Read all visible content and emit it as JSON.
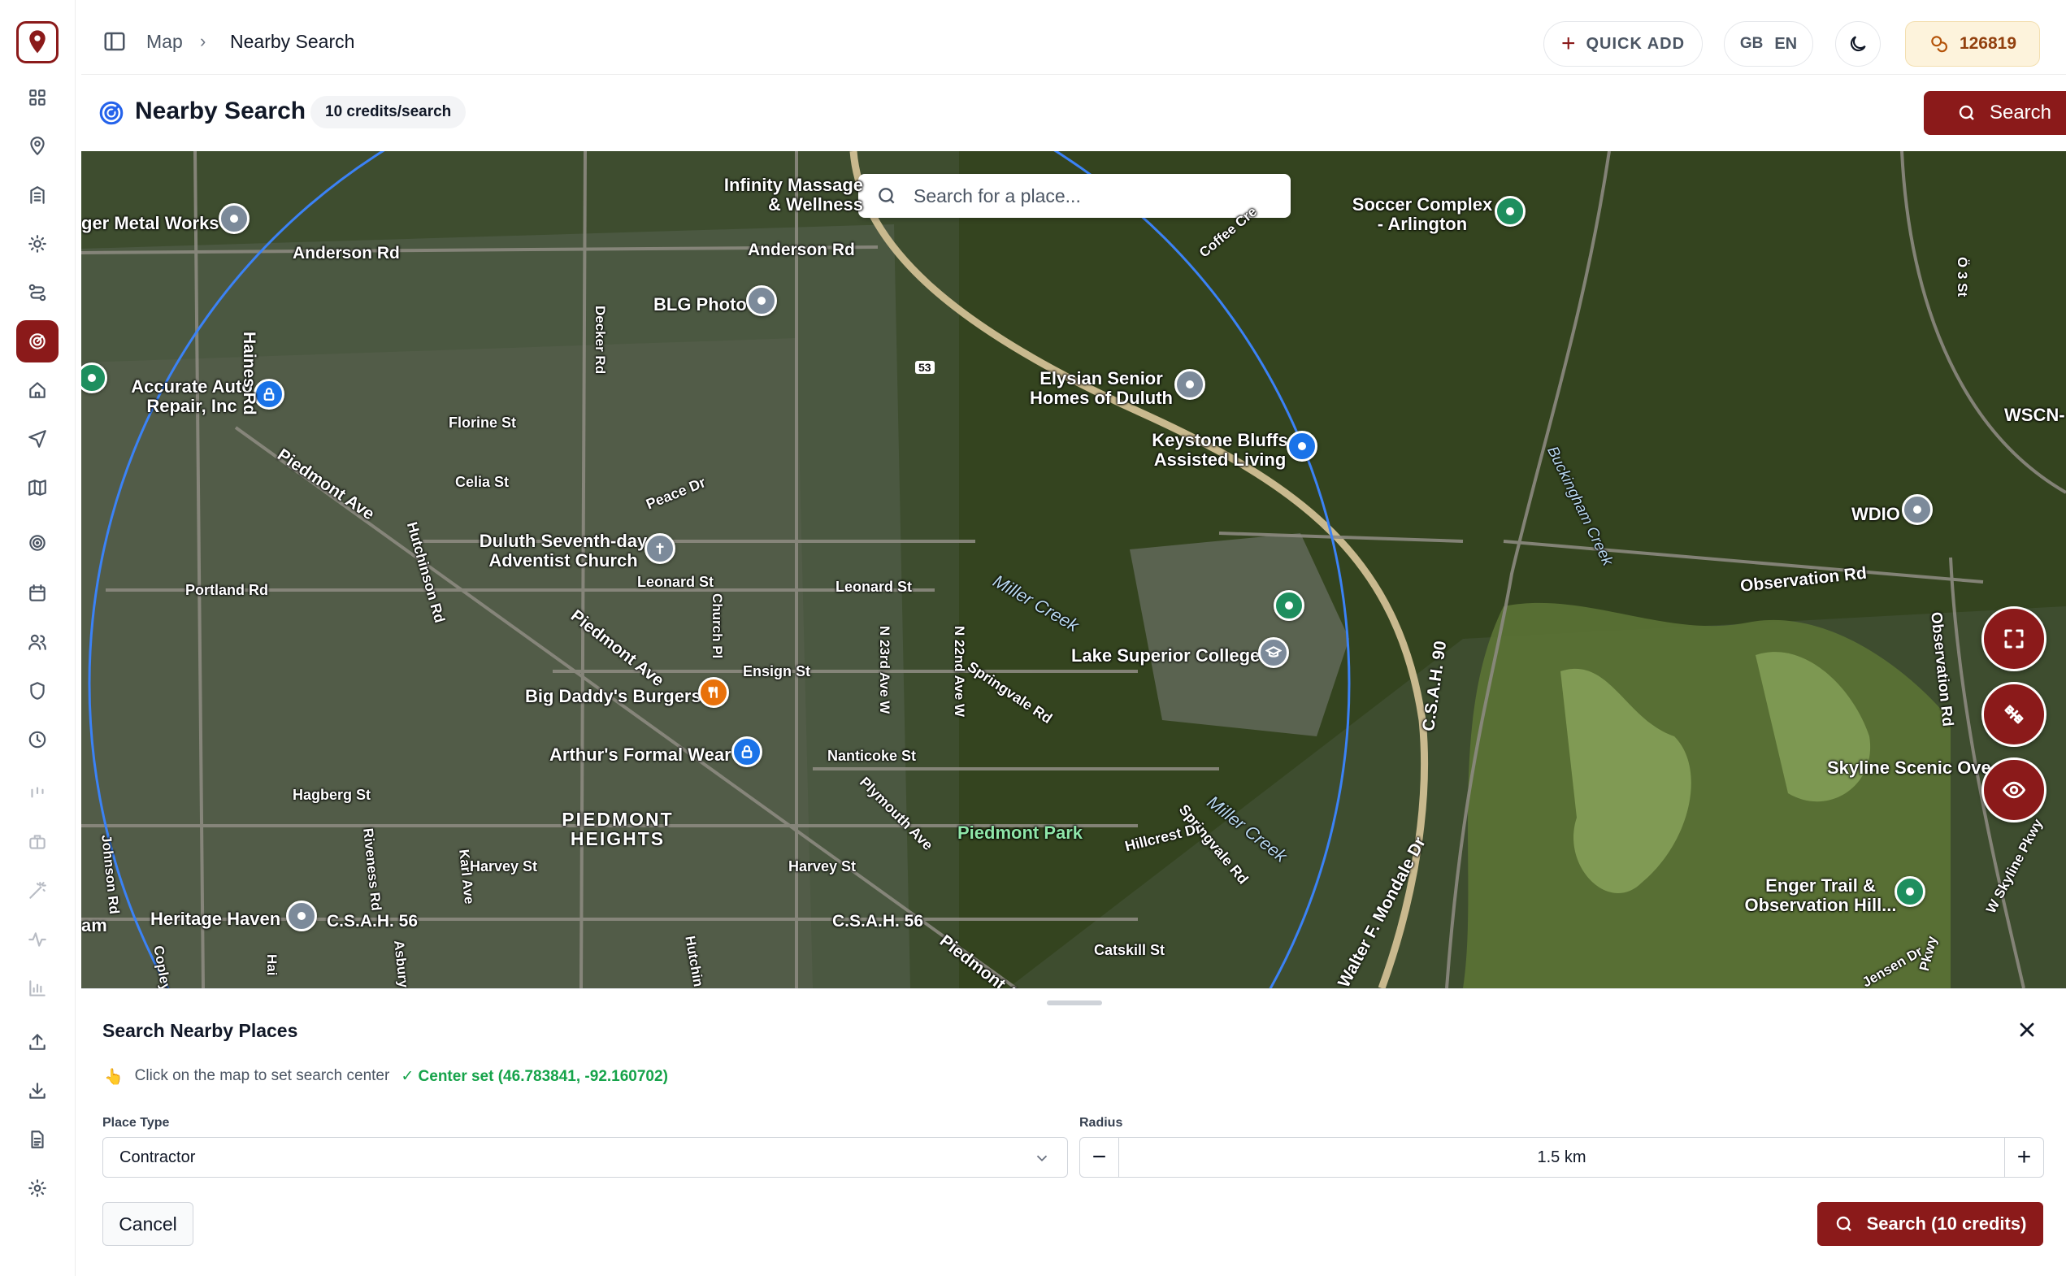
{
  "sidebar": {
    "logo_icon": "map-pin-logo-icon",
    "items": [
      {
        "icon": "grid-icon"
      },
      {
        "icon": "map-pin-icon"
      },
      {
        "icon": "building-icon"
      },
      {
        "icon": "sun-icon"
      },
      {
        "icon": "route-icon"
      },
      {
        "icon": "radar-icon",
        "active": true
      },
      {
        "icon": "home-icon"
      },
      {
        "icon": "send-icon"
      },
      {
        "icon": "map-icon"
      },
      {
        "icon": "target-icon"
      },
      {
        "icon": "calendar-icon"
      },
      {
        "icon": "users-icon"
      },
      {
        "icon": "shield-icon"
      },
      {
        "icon": "clock-icon"
      },
      {
        "icon": "bars-icon"
      },
      {
        "icon": "briefcase-icon"
      },
      {
        "icon": "wand-icon"
      },
      {
        "icon": "activity-icon"
      },
      {
        "icon": "chart-icon"
      },
      {
        "icon": "upload-icon"
      },
      {
        "icon": "download-icon"
      },
      {
        "icon": "document-icon"
      },
      {
        "icon": "settings-icon"
      }
    ]
  },
  "topbar": {
    "breadcrumb": [
      "Map",
      "Nearby Search"
    ],
    "separator": "›",
    "quick_add": "QUICK ADD",
    "lang_flag": "GB",
    "lang_code": "EN",
    "credits": "126819"
  },
  "header": {
    "title": "Nearby Search",
    "badge": "10 credits/search",
    "search_button": "Search"
  },
  "map": {
    "search_placeholder": "Search for a place...",
    "places": {
      "metal_works": "ger Metal Works",
      "blg_photo": "BLG Photo",
      "accurate_auto": "Accurate Auto\nRepair, Inc",
      "infinity": "Infinity Massage\n& Wellness",
      "elysian": "Elysian Senior\nHomes of Duluth",
      "keystone": "Keystone Bluffs\nAssisted Living",
      "soccer": "Soccer Complex\n- Arlington",
      "wdio": "WDIO",
      "wscn": "WSCN-",
      "duluth_sda": "Duluth Seventh-day\nAdventist Church",
      "lake_superior": "Lake Superior College",
      "big_daddy": "Big Daddy's Burgers",
      "arthurs": "Arthur's Formal Wear",
      "heritage": "Heritage Haven",
      "enger": "Enger Trail &\nObservation Hill...",
      "skyline": "Skyline Scenic Ove",
      "piedmont_heights": "PIEDMONT\nHEIGHTS",
      "piedmont_park": "Piedmont Park",
      "am": "am"
    },
    "roads": {
      "anderson_w": "Anderson Rd",
      "anderson_e": "Anderson Rd",
      "haines": "Haines Rd",
      "haines_low": "Hai",
      "decker": "Decker Rd",
      "florine": "Florine St",
      "celia": "Celia St",
      "piedmont_ave_1": "Piedmont Ave",
      "piedmont_ave_2": "Piedmont Ave",
      "piedmont_ave_3": "Piedmont Av",
      "peace": "Peace Dr",
      "portland": "Portland Rd",
      "hutchinson": "Hutchinson Rd",
      "hutchin_low": "Hutchin",
      "leonard_w": "Leonard St",
      "leonard_e": "Leonard St",
      "church": "Church Pl",
      "ensign": "Ensign St",
      "n23rd": "N 23rd Ave W",
      "n22nd": "N 22nd Ave W",
      "springvale_1": "Springvale Rd",
      "springvale_2": "Springvale Rd",
      "nanticoke": "Nanticoke St",
      "plymouth": "Plymouth Ave",
      "hagberg": "Hagberg St",
      "riveness": "Riveness Rd",
      "karl": "Karl Ave",
      "harvey_w": "Harvey St",
      "harvey_e": "Harvey St",
      "csah56_w": "C.S.A.H. 56",
      "csah56_e": "C.S.A.H. 56",
      "asbury": "Asbury",
      "johnson": "Johnson Rd",
      "copley": "Copley",
      "hillcrest": "Hillcrest Dr",
      "catskill": "Catskill St",
      "walter": "Walter F. Mondale Dr",
      "csah90": "C.S.A.H. 90",
      "observation_rd": "Observation Rd",
      "observation_v": "Observation Rd",
      "coffee": "Coffee Cre",
      "buckingham": "Buckingham Creek",
      "o3": "Ö 3 St",
      "skyline_pkwy": "W Skyline Pkwy",
      "pkwy": "Pkwy",
      "jensen": "Jensen Dr",
      "w_frag": "W",
      "hwy53": "53"
    },
    "water": {
      "miller_1": "Miller Creek",
      "miller_2": "Miller Creek"
    }
  },
  "panel": {
    "title": "Search Nearby Places",
    "hint_emoji": "👆",
    "hint": "Click on the map to set search center",
    "center_status": "✓ Center set (46.783841, -92.160702)",
    "place_type_label": "Place Type",
    "place_type_value": "Contractor",
    "radius_label": "Radius",
    "radius_value": "1.5 km",
    "minus": "−",
    "plus": "+",
    "cancel": "Cancel",
    "search_button": "Search (10 credits)"
  },
  "colors": {
    "brand": "#8b1a1a",
    "success": "#16a34a",
    "circle": "#3b82f6"
  }
}
